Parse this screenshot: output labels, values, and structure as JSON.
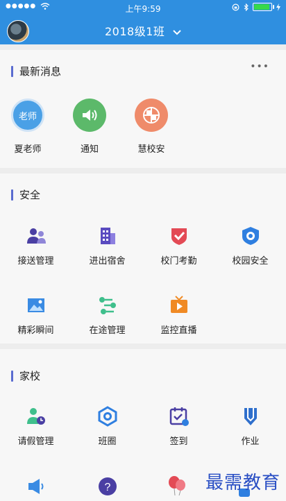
{
  "status_bar": {
    "signal": "●●●●●",
    "time": "上午9:59"
  },
  "header": {
    "title": "2018级1班"
  },
  "news": {
    "title": "最新消息",
    "more": "•••",
    "items": [
      {
        "label": "夏老师",
        "badge": "老师",
        "color": "#4aa0e6"
      },
      {
        "label": "通知",
        "color": "#5cb96a"
      },
      {
        "label": "慧校安",
        "color": "#ef8b6a"
      }
    ]
  },
  "safety": {
    "title": "安全",
    "items": [
      {
        "label": "接送管理",
        "icon": "people-icon"
      },
      {
        "label": "进出宿舍",
        "icon": "building-icon"
      },
      {
        "label": "校门考勤",
        "icon": "shield-check-icon"
      },
      {
        "label": "校园安全",
        "icon": "badge-icon"
      },
      {
        "label": "精彩瞬间",
        "icon": "picture-icon"
      },
      {
        "label": "在途管理",
        "icon": "route-icon"
      },
      {
        "label": "监控直播",
        "icon": "tv-play-icon"
      }
    ]
  },
  "home_school": {
    "title": "家校",
    "items": [
      {
        "label": "请假管理",
        "icon": "person-clock-icon"
      },
      {
        "label": "班圈",
        "icon": "hexagon-icon"
      },
      {
        "label": "签到",
        "icon": "calendar-check-icon"
      },
      {
        "label": "作业",
        "icon": "pen-icon"
      }
    ]
  },
  "watermark": "最需教育"
}
